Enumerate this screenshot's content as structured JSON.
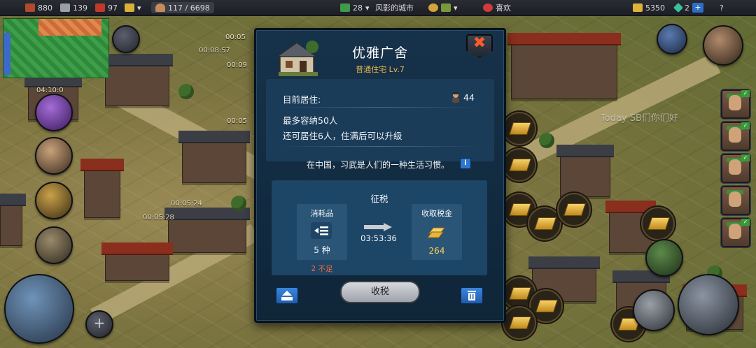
{
  "topbar": {
    "wood": "880",
    "tools": "139",
    "meat": "97",
    "population": "117 / 6698",
    "city_level": "28",
    "city_name": "风影的城市",
    "mood": "喜欢",
    "gold": "5350",
    "gems": "2",
    "help": "?"
  },
  "map_timers": [
    "00:05",
    "00:08:57",
    "00:09",
    "04:10:0",
    "00:05",
    "00:05:24",
    "00:05:28"
  ],
  "chat_text": "Today SB们你们好",
  "dialog": {
    "title": "优雅广舍",
    "subtitle": "普通住宅 Lv.7",
    "close_label": "✖",
    "residents_label": "目前居住:",
    "residents_count": "44",
    "capacity_text": "最多容纳50人",
    "upgrade_text": "还可居住6人，住满后可以升级",
    "fact_text": "在中国，习武是人们的一种生活习惯。",
    "info_label": "i",
    "tax": {
      "title": "征税",
      "consumables_label": "消耗品",
      "consumables_value": "5 种",
      "shortage_text": "2 不足",
      "countdown": "03:53:36",
      "collect_label": "收取税金",
      "collect_value": "264"
    },
    "collect_button": "收税"
  },
  "colors": {
    "dialog_bg": "#16324a",
    "accent_gold": "#ffd24a",
    "subtitle_gold": "#e8b34a",
    "warning": "#ff6a3a",
    "close_red": "#ff5a2a"
  }
}
